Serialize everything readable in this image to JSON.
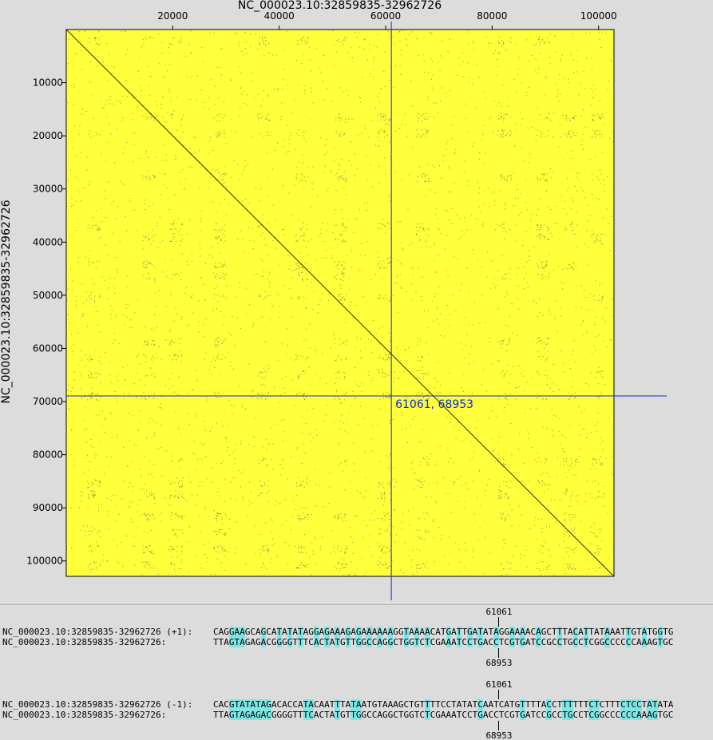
{
  "plot": {
    "x_title": "NC_000023.10:32859835-32962726",
    "y_title": "NC_000023.10:32859835-32962726",
    "x_ticks": [
      "20000",
      "40000",
      "60000",
      "80000",
      "100000"
    ],
    "y_ticks": [
      "10000",
      "20000",
      "30000",
      "40000",
      "50000",
      "60000",
      "70000",
      "80000",
      "90000",
      "100000"
    ],
    "background_color": "#ffff3c",
    "crosshair_color": "#0a2bd6",
    "cursor_readout": "61061, 68953"
  },
  "chart_data": {
    "type": "scatter",
    "title": "",
    "xlabel": "NC_000023.10:32859835-32962726",
    "ylabel": "NC_000023.10:32859835-32962726",
    "xlim": [
      1,
      102892
    ],
    "ylim": [
      1,
      102892
    ],
    "y_inverted": true,
    "x_ticks": [
      20000,
      40000,
      60000,
      80000,
      100000
    ],
    "y_ticks": [
      10000,
      20000,
      30000,
      40000,
      50000,
      60000,
      70000,
      80000,
      90000,
      100000
    ],
    "diagonal": [
      [
        1,
        1
      ],
      [
        102892,
        102892
      ]
    ],
    "crosshair": {
      "x": 61061,
      "y": 68953
    }
  },
  "alignments": [
    {
      "top_position": "61061",
      "bottom_position": "68953",
      "row1_label": "NC_000023.10:32859835-32962726 (+1):",
      "row1_seq": "CAGGAAGCAGCATATATAGGAGAAAGAGAAAAAAGGTAAAACATGATTGATATAGGAAAACAGCTTTACATTATAAATTGTATGGTG",
      "row2_label": "NC_000023.10:32859835-32962726:",
      "row2_seq": "TTAGTAGAGACGGGGTTTCACTATGTTGGCCAGGCTGGTCTCGAAATCCTGACCTCGTGATCCGCCTGCCTCGGCCCCCCAAAGTGC",
      "row1_highlights": [
        3,
        4,
        5,
        9,
        12,
        14,
        16,
        19,
        21,
        23,
        25,
        27,
        29,
        31,
        33,
        36,
        38,
        40,
        44,
        46,
        48,
        50,
        53,
        56,
        58,
        61,
        65,
        68,
        70,
        74,
        78,
        81,
        84
      ]
    },
    {
      "top_position": "61061",
      "bottom_position": "68953",
      "row1_label": "NC_000023.10:32859835-32962726 (-1):",
      "row1_seq": "CACGTATATAGACACCATACAATTTATAATGTAAAGCTGTTTTCCTATATCAATCATGTTTTACCTTTTTTCTCTTTCTCCTATATA",
      "row2_label": "NC_000023.10:32859835-32962726:",
      "row2_seq": "TTAGTAGAGACGGGGTTTCACTATGTTGGCCAGGCTGGTCTCGAAATCCTGACCTCGTGATCCGCCTGCCTCGGCCCCCCAAAGTGC",
      "row1_highlights": [
        3,
        4,
        5,
        6,
        7,
        8,
        9,
        10,
        17,
        18,
        23,
        26,
        27,
        40,
        50,
        58,
        63,
        66,
        67,
        71,
        72,
        77,
        78,
        79,
        80,
        82,
        83
      ]
    }
  ]
}
